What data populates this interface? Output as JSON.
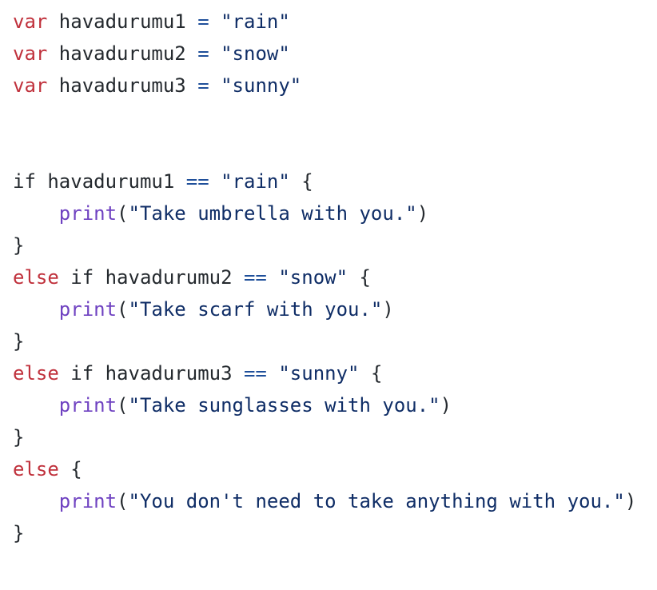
{
  "code": {
    "lines": [
      {
        "tokens": [
          {
            "type": "keyword",
            "text": "var"
          },
          {
            "type": "plain",
            "text": " havadurumu1 "
          },
          {
            "type": "operator",
            "text": "="
          },
          {
            "type": "plain",
            "text": " "
          },
          {
            "type": "string",
            "text": "\"rain\""
          }
        ]
      },
      {
        "tokens": [
          {
            "type": "keyword",
            "text": "var"
          },
          {
            "type": "plain",
            "text": " havadurumu2 "
          },
          {
            "type": "operator",
            "text": "="
          },
          {
            "type": "plain",
            "text": " "
          },
          {
            "type": "string",
            "text": "\"snow\""
          }
        ]
      },
      {
        "tokens": [
          {
            "type": "keyword",
            "text": "var"
          },
          {
            "type": "plain",
            "text": " havadurumu3 "
          },
          {
            "type": "operator",
            "text": "="
          },
          {
            "type": "plain",
            "text": " "
          },
          {
            "type": "string",
            "text": "\"sunny\""
          }
        ]
      },
      {
        "tokens": []
      },
      {
        "tokens": []
      },
      {
        "tokens": [
          {
            "type": "plain",
            "text": "if havadurumu1 "
          },
          {
            "type": "operator",
            "text": "=="
          },
          {
            "type": "plain",
            "text": " "
          },
          {
            "type": "string",
            "text": "\"rain\""
          },
          {
            "type": "plain",
            "text": " {"
          }
        ]
      },
      {
        "tokens": [
          {
            "type": "plain",
            "text": "    "
          },
          {
            "type": "func",
            "text": "print"
          },
          {
            "type": "punct",
            "text": "("
          },
          {
            "type": "string",
            "text": "\"Take umbrella with you.\""
          },
          {
            "type": "punct",
            "text": ")"
          }
        ]
      },
      {
        "tokens": [
          {
            "type": "plain",
            "text": "}"
          }
        ]
      },
      {
        "tokens": [
          {
            "type": "keyword",
            "text": "else"
          },
          {
            "type": "plain",
            "text": " if havadurumu2 "
          },
          {
            "type": "operator",
            "text": "=="
          },
          {
            "type": "plain",
            "text": " "
          },
          {
            "type": "string",
            "text": "\"snow\""
          },
          {
            "type": "plain",
            "text": " {"
          }
        ]
      },
      {
        "tokens": [
          {
            "type": "plain",
            "text": "    "
          },
          {
            "type": "func",
            "text": "print"
          },
          {
            "type": "punct",
            "text": "("
          },
          {
            "type": "string",
            "text": "\"Take scarf with you.\""
          },
          {
            "type": "punct",
            "text": ")"
          }
        ]
      },
      {
        "tokens": [
          {
            "type": "plain",
            "text": "}"
          }
        ]
      },
      {
        "tokens": [
          {
            "type": "keyword",
            "text": "else"
          },
          {
            "type": "plain",
            "text": " if havadurumu3 "
          },
          {
            "type": "operator",
            "text": "=="
          },
          {
            "type": "plain",
            "text": " "
          },
          {
            "type": "string",
            "text": "\"sunny\""
          },
          {
            "type": "plain",
            "text": " {"
          }
        ]
      },
      {
        "tokens": [
          {
            "type": "plain",
            "text": "    "
          },
          {
            "type": "func",
            "text": "print"
          },
          {
            "type": "punct",
            "text": "("
          },
          {
            "type": "string",
            "text": "\"Take sunglasses with you.\""
          },
          {
            "type": "punct",
            "text": ")"
          }
        ]
      },
      {
        "tokens": [
          {
            "type": "plain",
            "text": "}"
          }
        ]
      },
      {
        "tokens": [
          {
            "type": "keyword",
            "text": "else"
          },
          {
            "type": "plain",
            "text": " {"
          }
        ]
      },
      {
        "tokens": [
          {
            "type": "plain",
            "text": "    "
          },
          {
            "type": "func",
            "text": "print"
          },
          {
            "type": "punct",
            "text": "("
          },
          {
            "type": "string",
            "text": "\"You don't need to take anything with you.\""
          },
          {
            "type": "punct",
            "text": ")"
          }
        ]
      },
      {
        "tokens": [
          {
            "type": "plain",
            "text": "}"
          }
        ]
      }
    ]
  },
  "theme": {
    "background": "#ffffff",
    "keyword": "#c0313c",
    "plain": "#24292e",
    "operator": "#1f4f9a",
    "string": "#0f2d66",
    "function": "#6f42c1"
  }
}
